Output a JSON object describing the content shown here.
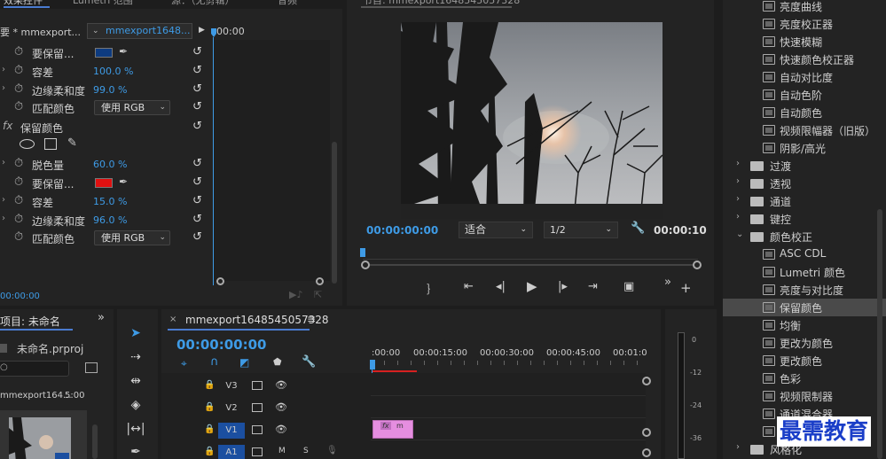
{
  "effect_controls": {
    "tabs": [
      "效果控件",
      "Lumetri 范围",
      "源：（无剪辑）",
      "音频"
    ],
    "source_label": "要 * mmexport...",
    "clip_dropdown": "mmexport1648...",
    "timecode_ruler": "00:00",
    "current_time": "00:00:00",
    "rows1": [
      {
        "label": "要保留...",
        "type": "color",
        "color": "#0d3b80"
      },
      {
        "label": "容差",
        "value": "100.0 %"
      },
      {
        "label": "边缘柔和度",
        "value": "99.0 %"
      },
      {
        "label": "匹配颜色",
        "select": "使用 RGB"
      }
    ],
    "effect2": {
      "fx": "fx",
      "name": "保留颜色"
    },
    "rows2": [
      {
        "label": "脱色量",
        "value": "60.0 %"
      },
      {
        "label": "要保留...",
        "type": "color",
        "color": "#e01010"
      },
      {
        "label": "容差",
        "value": "15.0 %"
      },
      {
        "label": "边缘柔和度",
        "value": "96.0 %"
      },
      {
        "label": "匹配颜色",
        "select": "使用 RGB"
      }
    ]
  },
  "program_monitor": {
    "title": "节目: mmexport1648545057328",
    "timecode": "00:00:00:00",
    "fit": "适合",
    "resolution": "1/2",
    "duration": "00:00:10"
  },
  "project": {
    "title": "项目: 未命名",
    "file": "未命名.prproj",
    "item_name": "mmexport164...",
    "item_duration": "5:00"
  },
  "timeline": {
    "sequence": "mmexport1648545057328",
    "timecode": "00:00:00:00",
    "ruler": [
      ":00:00",
      "00:00:15:00",
      "00:00:30:00",
      "00:00:45:00",
      "00:01:0"
    ],
    "tracks": [
      {
        "name": "V3"
      },
      {
        "name": "V2"
      },
      {
        "name": "V1"
      },
      {
        "name": "A1",
        "m": "M",
        "s": "S"
      }
    ],
    "clip_fx": "fx",
    "clip_label": "m"
  },
  "audio_meter": {
    "ticks": [
      "0",
      "-12",
      "-24",
      "-36"
    ]
  },
  "effects_panel": {
    "items_top": [
      "亮度曲线",
      "亮度校正器",
      "快速模糊",
      "快速颜色校正器",
      "自动对比度",
      "自动色阶",
      "自动颜色",
      "视频限幅器（旧版）",
      "阴影/高光"
    ],
    "folders": [
      "过渡",
      "透视",
      "通道",
      "键控"
    ],
    "open_folder": "颜色校正",
    "items_color": [
      "ASC CDL",
      "Lumetri 颜色",
      "亮度与对比度",
      "保留颜色",
      "均衡",
      "更改为颜色",
      "更改颜色",
      "色彩",
      "视频限制器",
      "通道混合器",
      "颜色平衡（HLS）"
    ],
    "selected": "保留颜色",
    "bottom_folder": "风格化"
  },
  "watermark": "最需教育"
}
